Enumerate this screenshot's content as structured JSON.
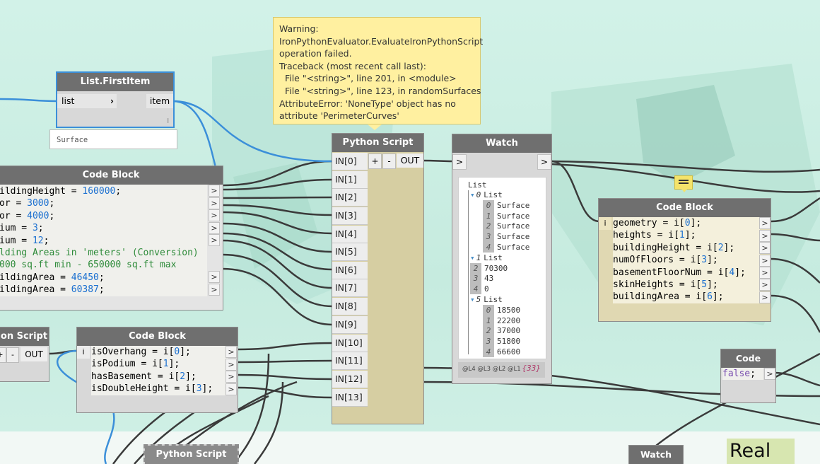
{
  "tooltip": {
    "lines": [
      "Warning:",
      "IronPythonEvaluator.EvaluateIronPythonScript",
      "operation failed.",
      "Traceback (most recent call last):",
      "  File \"<string>\", line 201, in <module>",
      "  File \"<string>\", line 123, in randomSurfaces",
      "AttributeError: 'NoneType' object has no",
      "attribute 'PerimeterCurves'"
    ]
  },
  "first_item_node": {
    "title": "List.FirstItem",
    "in_port": "list",
    "out_port": "item",
    "lacing": "l",
    "preview": "Surface"
  },
  "code_block_left": {
    "title": "Code Block",
    "lines": [
      {
        "prefix": "ildingHeight = ",
        "value": "160000",
        "suffix": ";"
      },
      {
        "prefix": "or = ",
        "value": "3000",
        "suffix": ";"
      },
      {
        "prefix": "or = ",
        "value": "4000",
        "suffix": ";"
      },
      {
        "prefix": "ium = ",
        "value": "3",
        "suffix": ";"
      },
      {
        "prefix": "ium = ",
        "value": "12",
        "suffix": ";"
      },
      {
        "comment": "lding Areas in 'meters' (Conversion)"
      },
      {
        "comment": "000 sq.ft min - 650000 sq.ft max"
      },
      {
        "prefix": "ildingArea = ",
        "value": "46450",
        "suffix": ";"
      },
      {
        "prefix": "ildingArea = ",
        "value": "60387",
        "suffix": ";"
      }
    ]
  },
  "python_left": {
    "title": "on Script",
    "plus": "+",
    "minus": "-",
    "out": "OUT"
  },
  "code_block_mid": {
    "title": "Code Block",
    "in_port": "i",
    "lines": [
      {
        "prefix": "isOverhang = i[",
        "value": "0",
        "suffix": "];"
      },
      {
        "prefix": "isPodium = i[",
        "value": "1",
        "suffix": "];"
      },
      {
        "prefix": "hasBasement = i[",
        "value": "2",
        "suffix": "];"
      },
      {
        "prefix": "isDoubleHeight = i[",
        "value": "3",
        "suffix": "];"
      }
    ]
  },
  "python_main": {
    "title": "Python Script",
    "plus": "+",
    "minus": "-",
    "out": "OUT",
    "inputs": [
      "IN[0]",
      "IN[1]",
      "IN[2]",
      "IN[3]",
      "IN[4]",
      "IN[5]",
      "IN[6]",
      "IN[7]",
      "IN[8]",
      "IN[9]",
      "IN[10]",
      "IN[11]",
      "IN[12]",
      "IN[13]"
    ]
  },
  "watch_main": {
    "title": "Watch",
    "in_arrow": ">",
    "out_arrow": ">",
    "root": "List",
    "rows": [
      {
        "indent": 1,
        "kind": "head",
        "idx": "0",
        "label": "List"
      },
      {
        "indent": 2,
        "kind": "item",
        "idx": "0",
        "label": "Surface"
      },
      {
        "indent": 2,
        "kind": "item",
        "idx": "1",
        "label": "Surface"
      },
      {
        "indent": 2,
        "kind": "item",
        "idx": "2",
        "label": "Surface"
      },
      {
        "indent": 2,
        "kind": "item",
        "idx": "3",
        "label": "Surface"
      },
      {
        "indent": 2,
        "kind": "item",
        "idx": "4",
        "label": "Surface"
      },
      {
        "indent": 1,
        "kind": "head",
        "idx": "1",
        "label": "List"
      },
      {
        "indent": 1,
        "kind": "item",
        "idx": "2",
        "label": "70300"
      },
      {
        "indent": 1,
        "kind": "item",
        "idx": "3",
        "label": "43"
      },
      {
        "indent": 1,
        "kind": "item",
        "idx": "4",
        "label": "0"
      },
      {
        "indent": 1,
        "kind": "head",
        "idx": "5",
        "label": "List"
      },
      {
        "indent": 2,
        "kind": "item",
        "idx": "0",
        "label": "18500"
      },
      {
        "indent": 2,
        "kind": "item",
        "idx": "1",
        "label": "22200"
      },
      {
        "indent": 2,
        "kind": "item",
        "idx": "2",
        "label": "37000"
      },
      {
        "indent": 2,
        "kind": "item",
        "idx": "3",
        "label": "51800"
      },
      {
        "indent": 2,
        "kind": "item",
        "idx": "4",
        "label": "66600"
      }
    ],
    "levels": "@L4 @L3 @L2 @L1",
    "count": "{33}"
  },
  "code_block_right": {
    "title": "Code Block",
    "in_port": "i",
    "lines": [
      {
        "prefix": "geometry = i[",
        "value": "0",
        "suffix": "];"
      },
      {
        "prefix": "heights = i[",
        "value": "1",
        "suffix": "];"
      },
      {
        "prefix": "buildingHeight = i[",
        "value": "2",
        "suffix": "];"
      },
      {
        "prefix": "numOfFloors = i[",
        "value": "3",
        "suffix": "];"
      },
      {
        "prefix": "basementFloorNum = i[",
        "value": "4",
        "suffix": "];"
      },
      {
        "prefix": "skinHeights = i[",
        "value": "5",
        "suffix": "];"
      },
      {
        "prefix": "buildingArea = i[",
        "value": "6",
        "suffix": "];"
      }
    ]
  },
  "code_block_false": {
    "title": "Code Block",
    "value": "false",
    "suffix": ";"
  },
  "bottom_python": {
    "title": "Python Script"
  },
  "bottom_watch": {
    "title": "Watch"
  },
  "bottom_real": {
    "label": "Real"
  },
  "colors": {
    "canvas": "#cdeee4",
    "node_header": "#6f6f6f",
    "selected_border": "#3b8fd9",
    "tooltip": "#fff0a0",
    "wire": "#3a3a3a",
    "wire_selected": "#3b8fd9"
  }
}
